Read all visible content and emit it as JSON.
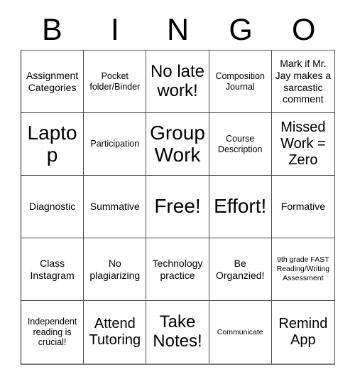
{
  "header": {
    "letters": [
      "B",
      "I",
      "N",
      "G",
      "O"
    ]
  },
  "grid": {
    "rows": 5,
    "columns": 5,
    "cells": [
      {
        "text": "Assignment Categories",
        "size": "md"
      },
      {
        "text": "Pocket folder/Binder",
        "size": "sm"
      },
      {
        "text": "No late work!",
        "size": "xl"
      },
      {
        "text": "Composition Journal",
        "size": "sm"
      },
      {
        "text": "Mark if Mr. Jay makes a sarcastic comment",
        "size": "md"
      },
      {
        "text": "Laptop",
        "size": "xxl"
      },
      {
        "text": "Participation",
        "size": "sm"
      },
      {
        "text": "Group Work",
        "size": "xxl"
      },
      {
        "text": "Course Description",
        "size": "sm"
      },
      {
        "text": "Missed Work = Zero",
        "size": "lg"
      },
      {
        "text": "Diagnostic",
        "size": "md"
      },
      {
        "text": "Summative",
        "size": "md"
      },
      {
        "text": "Free!",
        "size": "xxl"
      },
      {
        "text": "Effort!",
        "size": "xxl"
      },
      {
        "text": "Formative",
        "size": "md"
      },
      {
        "text": "Class Instagram",
        "size": "md"
      },
      {
        "text": "No plagiarizing",
        "size": "md"
      },
      {
        "text": "Technology practice",
        "size": "md"
      },
      {
        "text": "Be Organzied!",
        "size": "md"
      },
      {
        "text": "9th grade FAST Reading/Writing Assessment",
        "size": "xs"
      },
      {
        "text": "Independent reading is crucial!",
        "size": "sm"
      },
      {
        "text": "Attend Tutoring",
        "size": "lg"
      },
      {
        "text": "Take Notes!",
        "size": "xl"
      },
      {
        "text": "Communicate",
        "size": "xs"
      },
      {
        "text": "Remind App",
        "size": "lg"
      }
    ]
  }
}
